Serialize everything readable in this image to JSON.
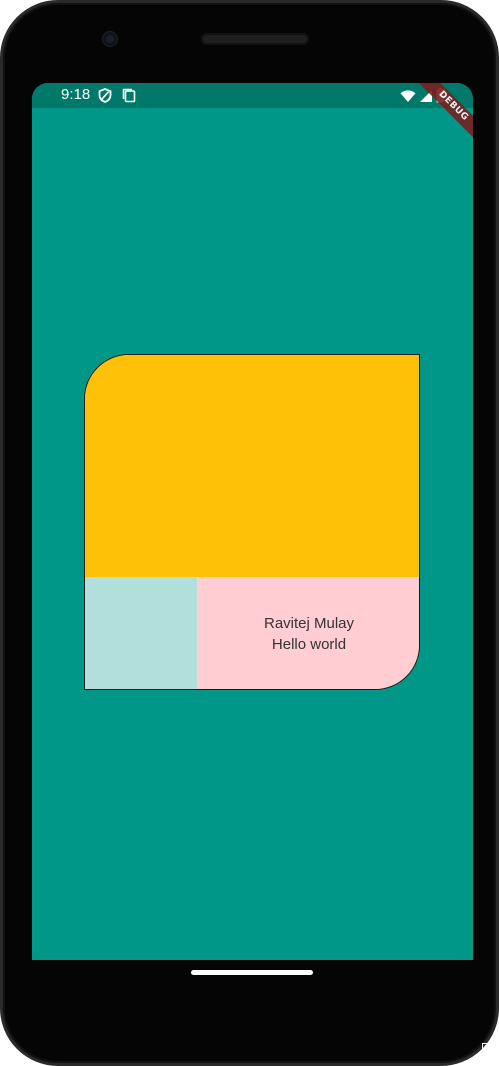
{
  "status_bar": {
    "time": "9:18",
    "icons": [
      "shield-icon",
      "clipboard-icon",
      "wifi-icon",
      "signal-icon",
      "battery-icon"
    ]
  },
  "debug_banner": {
    "label": "DEBUG",
    "color": "#7a1e1e"
  },
  "card": {
    "name": "Ravitej Mulay",
    "subtitle": "Hello world",
    "colors": {
      "top": "#ffc107",
      "bottom_left": "#b2dfdb",
      "bottom_right": "#ffcdd2"
    }
  },
  "colors": {
    "background": "#009688",
    "status_bar": "#00796b"
  }
}
